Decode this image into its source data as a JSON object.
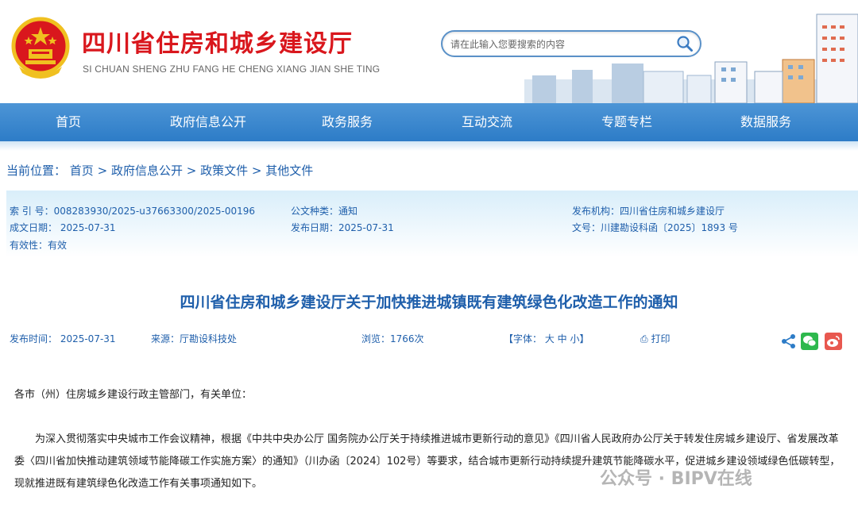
{
  "site": {
    "title": "四川省住房和城乡建设厅",
    "subtitle": "SI CHUAN SHENG ZHU FANG HE CHENG XIANG JIAN SHE TING"
  },
  "search": {
    "placeholder": "请在此输入您要搜索的内容"
  },
  "nav": [
    "首页",
    "政府信息公开",
    "政务服务",
    "互动交流",
    "专题专栏",
    "数据服务"
  ],
  "breadcrumb": {
    "label": "当前位置：",
    "items": [
      "首页",
      "政府信息公开",
      "政策文件",
      "其他文件"
    ],
    "sep": ">"
  },
  "meta": {
    "index_no": "索 引 号：008283930/2025-u37663300/2025-00196",
    "category": "公文种类：通知",
    "publisher": "发布机构：四川省住房和城乡建设厅",
    "written_date": "成文日期：  2025-07-31",
    "publish_date": "发布日期：2025-07-31",
    "doc_no": "文号：川建勘设科函〔2025〕1893 号",
    "validity": "有效性：有效"
  },
  "doc_title": "四川省住房和城乡建设厅关于加快推进城镇既有建筑绿色化改造工作的通知",
  "info": {
    "time": "发布时间：  2025-07-31",
    "source": "来源：厅勘设科技处",
    "views": "浏览：1766次",
    "font": "【字体： 大 中 小】",
    "print": "打印"
  },
  "body": {
    "salutation": "各市（州）住房城乡建设行政主管部门，有关单位：",
    "paragraph": "为深入贯彻落实中央城市工作会议精神，根据《中共中央办公厅 国务院办公厅关于持续推进城市更新行动的意见》《四川省人民政府办公厅关于转发住房城乡建设厅、省发展改革委〈四川省加快推动建筑领域节能降碳工作实施方案〉的通知》（川办函〔2024〕102号）等要求，结合城市更新行动持续提升建筑节能降碳水平，促进城乡建设领域绿色低碳转型，现就推进既有建筑绿色化改造工作有关事项通知如下。"
  },
  "watermark": "公众号 · BIPV在线",
  "colors": {
    "red": "#d9171d",
    "blue": "#1f5fab",
    "nav": "#2d7cc7"
  }
}
